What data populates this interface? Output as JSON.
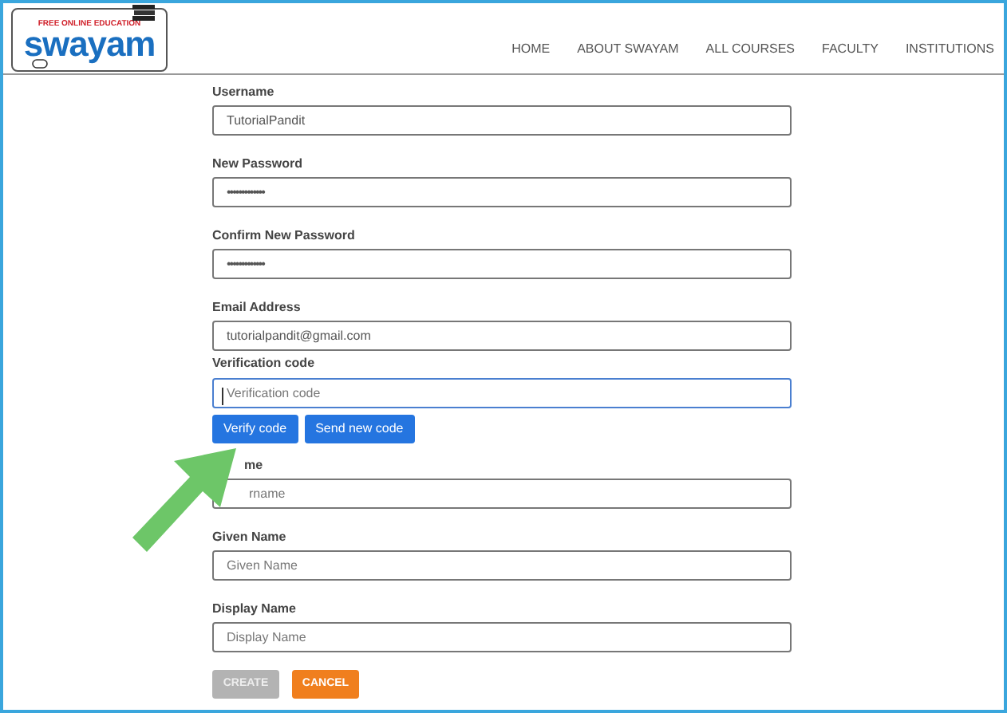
{
  "logo": {
    "tagline": "FREE ONLINE EDUCATION",
    "name": "swayam"
  },
  "nav": [
    "HOME",
    "ABOUT SWAYAM",
    "ALL COURSES",
    "FACULTY",
    "INSTITUTIONS"
  ],
  "fields": [
    {
      "label": "Username",
      "kind": "text",
      "value": "TutorialPandit",
      "focused": false
    },
    {
      "label": "New Password",
      "kind": "password",
      "value": "•••••••••••••",
      "focused": false
    },
    {
      "label": "Confirm New Password",
      "kind": "password",
      "value": "•••••••••••••",
      "focused": false
    },
    {
      "label": "Email Address",
      "kind": "text",
      "value": "tutorialpandit@gmail.com",
      "focused": false
    },
    {
      "label": "Verification code",
      "kind": "text",
      "placeholder": "Verification code",
      "focused": true,
      "actions": [
        "Verify code",
        "Send new code"
      ]
    },
    {
      "label": "me",
      "kind": "text",
      "placeholder": "rname",
      "focused": false,
      "covered": true
    },
    {
      "label": "Given Name",
      "kind": "text",
      "placeholder": "Given Name",
      "focused": false
    },
    {
      "label": "Display Name",
      "kind": "text",
      "placeholder": "Display Name",
      "focused": false
    }
  ],
  "buttons": [
    {
      "label": "CREATE",
      "disabled": true
    },
    {
      "label": "CANCEL",
      "disabled": false
    }
  ]
}
